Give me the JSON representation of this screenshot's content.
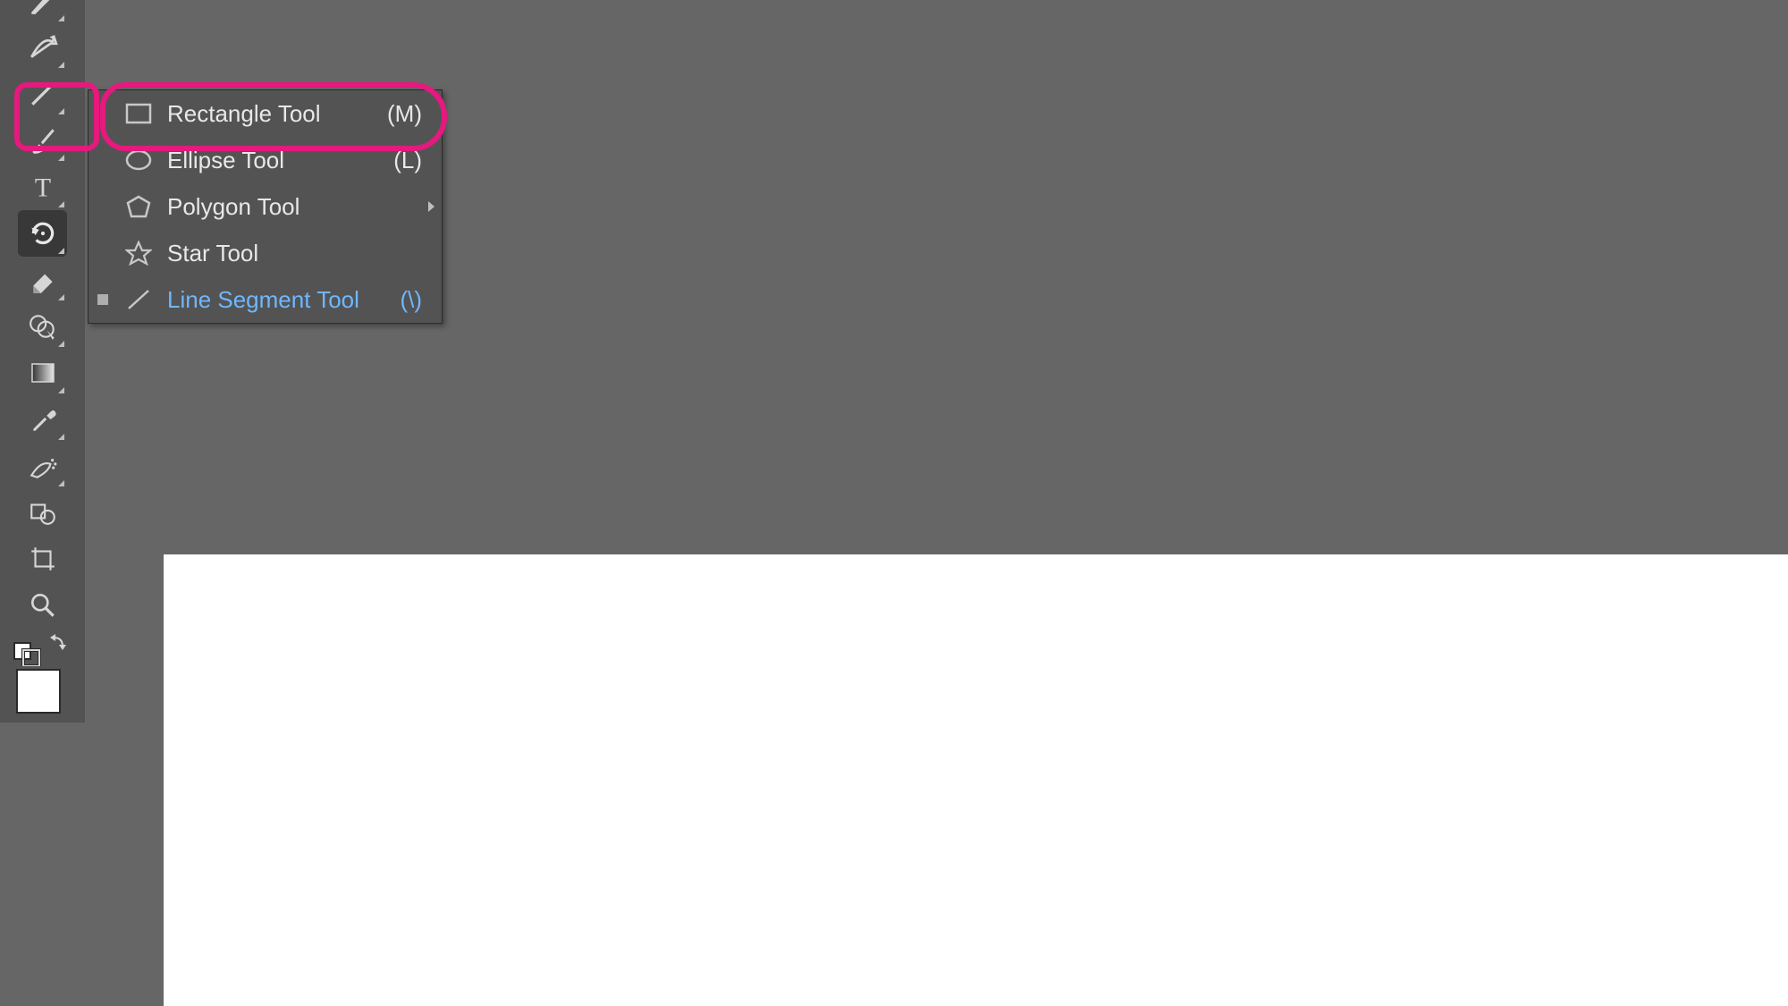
{
  "toolbar": {
    "tools": [
      {
        "name": "pen-tool",
        "flyout": true
      },
      {
        "name": "curvature-tool",
        "flyout": true
      },
      {
        "name": "line-segment-tool",
        "flyout": true,
        "highlighted": true
      },
      {
        "name": "paintbrush-tool",
        "flyout": true
      },
      {
        "name": "type-tool",
        "flyout": true
      },
      {
        "name": "rotate-tool",
        "flyout": true,
        "selected": true
      },
      {
        "name": "eraser-tool",
        "flyout": true
      },
      {
        "name": "shape-builder-tool",
        "flyout": true
      },
      {
        "name": "gradient-tool",
        "flyout": true
      },
      {
        "name": "eyedropper-tool",
        "flyout": true
      },
      {
        "name": "symbol-sprayer-tool",
        "flyout": true
      },
      {
        "name": "blend-tool",
        "flyout": false
      },
      {
        "name": "artboard-tool",
        "flyout": false
      },
      {
        "name": "zoom-tool",
        "flyout": false
      }
    ]
  },
  "flyout": {
    "items": [
      {
        "icon": "rectangle-icon",
        "label": "Rectangle Tool",
        "shortcut": "(M)",
        "highlighted": true
      },
      {
        "icon": "ellipse-icon",
        "label": "Ellipse Tool",
        "shortcut": "(L)"
      },
      {
        "icon": "polygon-icon",
        "label": "Polygon Tool",
        "shortcut": "",
        "submenu": true
      },
      {
        "icon": "star-icon",
        "label": "Star Tool",
        "shortcut": ""
      },
      {
        "icon": "line-icon",
        "label": "Line Segment Tool",
        "shortcut": "(\\)",
        "active": true,
        "marked": true
      }
    ]
  },
  "colors": {
    "fill": "#ffffff"
  }
}
